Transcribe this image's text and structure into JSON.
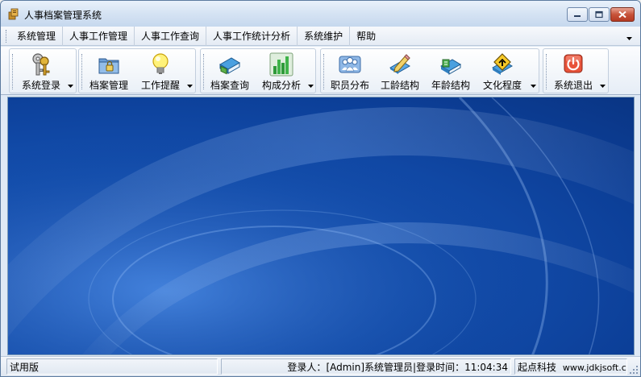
{
  "window": {
    "title": "人事档案管理系统"
  },
  "menu": {
    "items": [
      "系统管理",
      "人事工作管理",
      "人事工作查询",
      "人事工作统计分析",
      "系统维护",
      "帮助"
    ]
  },
  "toolbar": {
    "system_login": "系统登录",
    "archive_management": "档案管理",
    "work_reminder": "工作提醒",
    "archive_query": "档案查询",
    "composition_analysis": "构成分析",
    "staff_distribution": "职员分布",
    "seniority_structure": "工龄结构",
    "age_structure": "年龄结构",
    "education_level": "文化程度",
    "system_exit": "系统退出"
  },
  "statusbar": {
    "edition": "试用版",
    "login_user_label": "登录人：",
    "login_user_value": "[Admin]系统管理员",
    "login_time_label": "|登录时间：",
    "login_time_value": "11:04:34",
    "company": "起点科技",
    "website": "www.jdkjsoft.cc"
  },
  "colors": {
    "accent": "#1450b0",
    "title_bg": "#d5e3f3",
    "close_button": "#c75339"
  },
  "icons": {
    "app": "app-icon",
    "system_login": "keys-icon",
    "archive_management": "folder-lock-icon",
    "work_reminder": "lightbulb-icon",
    "archive_query": "book-search-icon",
    "composition_analysis": "bar-chart-icon",
    "staff_distribution": "people-icon",
    "seniority_structure": "pencil-icon",
    "age_structure": "books-icon",
    "education_level": "book-sign-icon",
    "system_exit": "power-icon"
  }
}
